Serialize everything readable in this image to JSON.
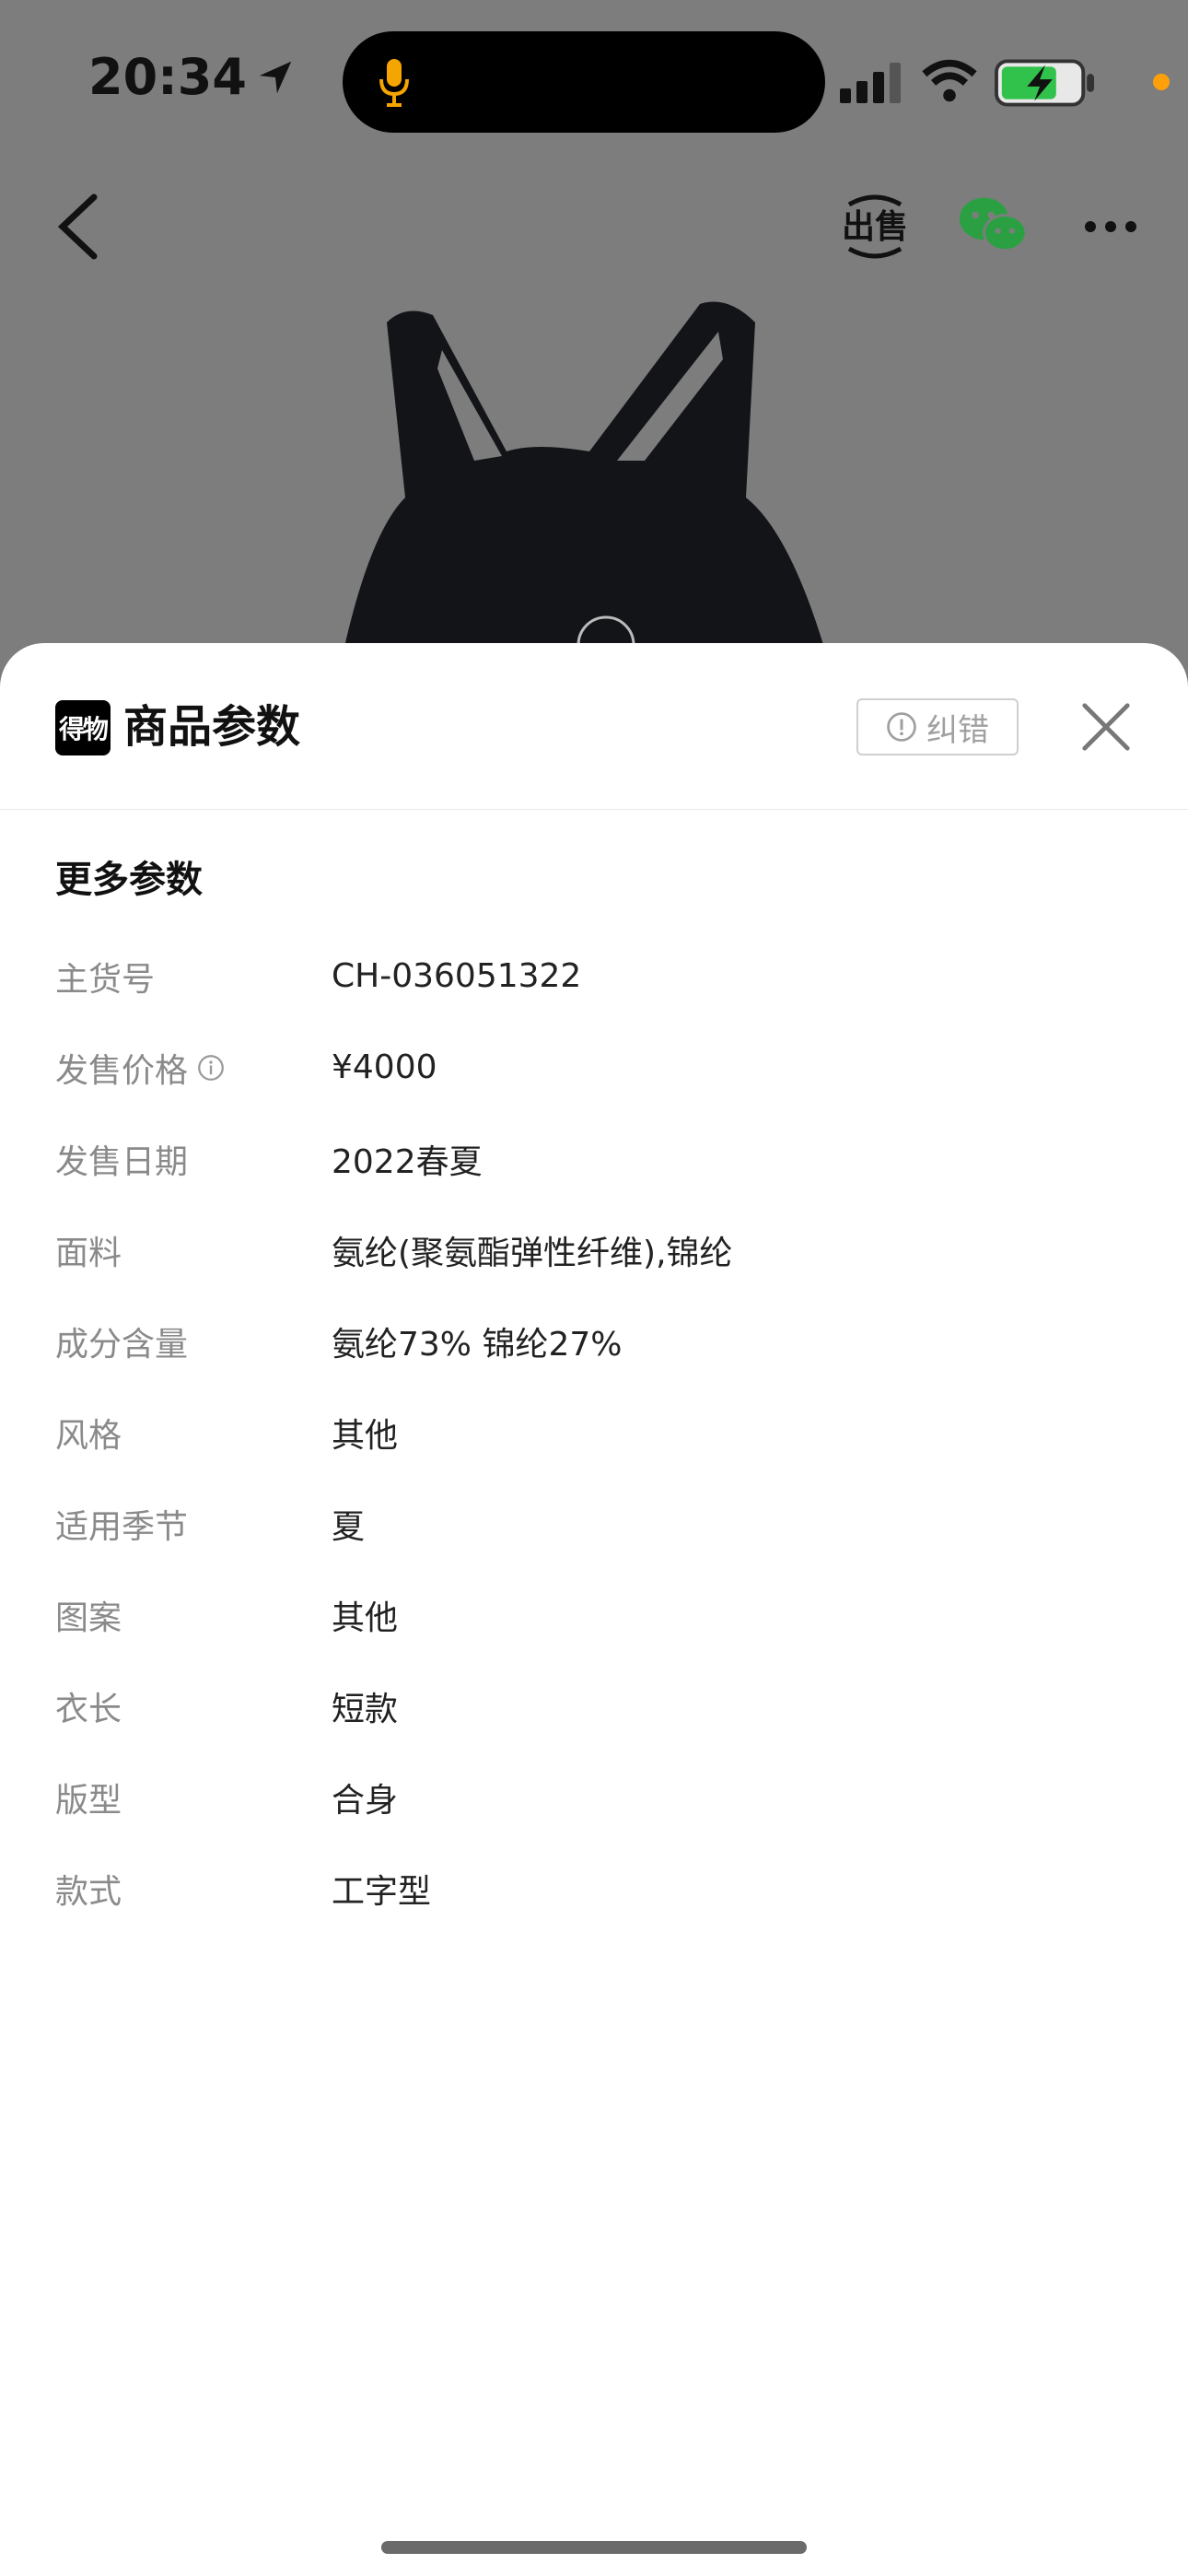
{
  "status": {
    "time": "20:34",
    "location_icon": "location-arrow-icon",
    "mic_color": "#f4a500",
    "battery_color": "#30c24a",
    "recording_dot_color": "#ff9f0a"
  },
  "nav": {
    "back_icon": "back-chevron-icon",
    "sell_icon": "sell-icon",
    "wechat_icon": "wechat-icon",
    "more_icon": "more-icon"
  },
  "sheet": {
    "logo_text": "得物",
    "title": "商品参数",
    "report_label": "纠错",
    "section_title": "更多参数",
    "params": [
      {
        "key": "主货号",
        "value": "CH-036051322"
      },
      {
        "key": "发售价格",
        "value": "¥4000",
        "info": true
      },
      {
        "key": "发售日期",
        "value": "2022春夏"
      },
      {
        "key": "面料",
        "value": "氨纶(聚氨酯弹性纤维),锦纶"
      },
      {
        "key": "成分含量",
        "value": "氨纶73% 锦纶27%"
      },
      {
        "key": "风格",
        "value": "其他"
      },
      {
        "key": "适用季节",
        "value": "夏"
      },
      {
        "key": "图案",
        "value": "其他"
      },
      {
        "key": "衣长",
        "value": "短款"
      },
      {
        "key": "版型",
        "value": "合身"
      },
      {
        "key": "款式",
        "value": "工字型"
      }
    ]
  },
  "colors": {
    "overlay_bg": "#7d7d7d",
    "key_text": "#8a8a8a",
    "value_text": "#222222",
    "wechat_green": "#2aa043"
  }
}
